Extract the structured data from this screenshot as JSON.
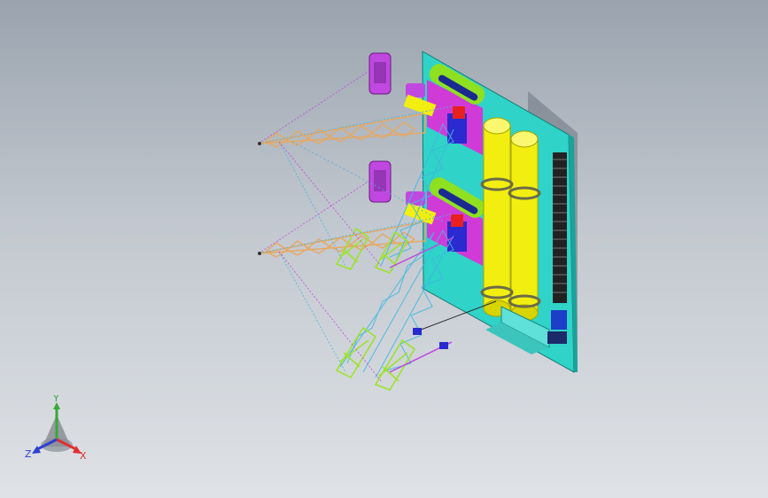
{
  "triad": {
    "x_label": "X",
    "y_label": "Y",
    "z_label": "Z",
    "x_color": "#e03030",
    "y_color": "#3aa83a",
    "z_color": "#2f3fd0"
  },
  "model": {
    "plate_color": "#2fd3c8",
    "tank_color": "#f2ee10",
    "boom_color": "#e8a860",
    "base_color": "#9ee22a",
    "counterweight_color": "#b040d8",
    "cable_color": "#40b8e0"
  }
}
